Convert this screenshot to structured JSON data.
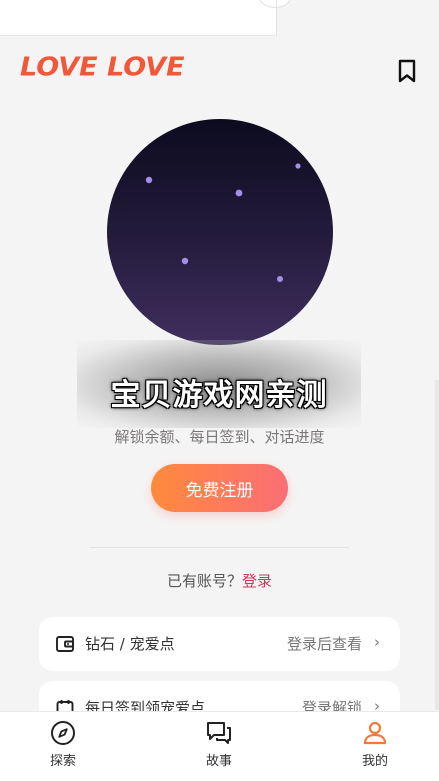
{
  "header": {
    "logo_text": "LOVE LOVE",
    "bookmark_icon": "bookmark-icon"
  },
  "watermark": {
    "text": "宝贝游戏网亲测"
  },
  "profile": {
    "subtitle": "解锁余额、每日签到、对话进度",
    "register_label": "免费注册",
    "login_prompt": "已有账号？",
    "login_link": "登录"
  },
  "rows": [
    {
      "label": "钻石 / 宠爱点",
      "value": "登录后查看",
      "chevron": "›",
      "icon": "wallet-icon"
    },
    {
      "label": "每日签到领宠爱点",
      "value": "登录解锁",
      "chevron": "›",
      "icon": "calendar-icon"
    }
  ],
  "tabbar": {
    "items": [
      {
        "label": "探索",
        "icon": "compass-icon"
      },
      {
        "label": "故事",
        "icon": "chat-bubbles-icon"
      },
      {
        "label": "我的",
        "icon": "user-icon",
        "active": true
      }
    ]
  },
  "colors": {
    "accent": "#f3573a",
    "login_link": "#d0365e",
    "active_tab": "#f07a3a",
    "button_gradient_start": "#ff8a3c",
    "button_gradient_end": "#fb6e76"
  }
}
